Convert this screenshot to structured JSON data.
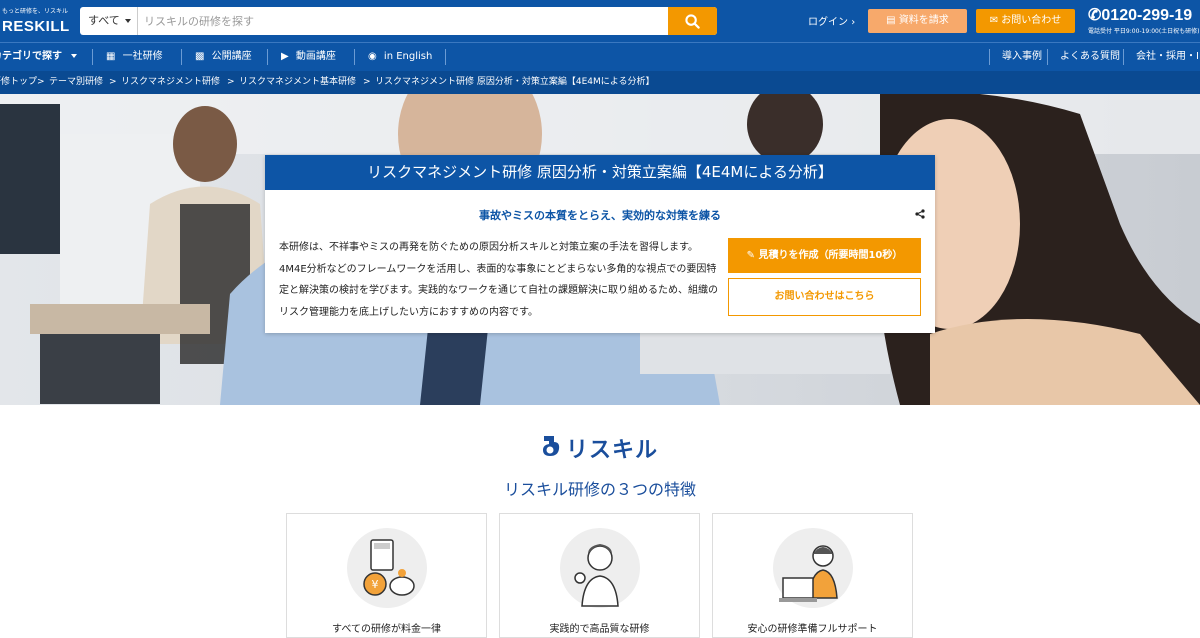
{
  "header": {
    "logo_tagline": "もっと研修を、リスキル",
    "logo_text": "RESKILL",
    "search": {
      "category": "すべて",
      "placeholder": "リスキルの研修を探す"
    },
    "login": "ログイン",
    "request_docs": "資料を請求",
    "contact": "お問い合わせ",
    "phone": "0120-299-19",
    "phone_hours": "電話受付 平日9:00-19:00(土日祝も研修)"
  },
  "nav": {
    "category": "カテゴリで探す",
    "items": [
      "一社研修",
      "公開講座",
      "動画講座",
      "in English"
    ],
    "right_items": [
      "導入事例",
      "よくある質問",
      "会社・採用・IR"
    ]
  },
  "breadcrumb": [
    "研修トップ",
    "テーマ別研修",
    "リスクマネジメント研修",
    "リスクマネジメント基本研修",
    "リスクマネジメント研修 原因分析・対策立案編【4E4Mによる分析】"
  ],
  "card": {
    "title": "リスクマネジメント研修 原因分析・対策立案編【4E4Mによる分析】",
    "subtitle": "事故やミスの本質をとらえ、実効的な対策を練る",
    "description": "本研修は、不祥事やミスの再発を防ぐための原因分析スキルと対策立案の手法を習得します。4M4E分析などのフレームワークを活用し、表面的な事象にとどまらない多角的な視点での要因特定と解決策の検討を学びます。実践的なワークを通じて自社の課題解決に取り組めるため、組織のリスク管理能力を底上げしたい方におすすめの内容です。",
    "estimate_button": "見積りを作成（所要時間10秒）",
    "inquiry_button": "お問い合わせはこちら"
  },
  "features": {
    "brand": "リスキル",
    "title": "リスキル研修の３つの特徴",
    "items": [
      {
        "label": "すべての研修が料金一律",
        "icon": "calculator-piggybank-icon"
      },
      {
        "label": "実践的で高品質な研修",
        "icon": "instructor-ok-icon"
      },
      {
        "label": "安心の研修準備フルサポート",
        "icon": "support-laptop-icon"
      }
    ]
  },
  "colors": {
    "brand_blue": "#0d55a6",
    "accent_orange": "#f39800"
  }
}
